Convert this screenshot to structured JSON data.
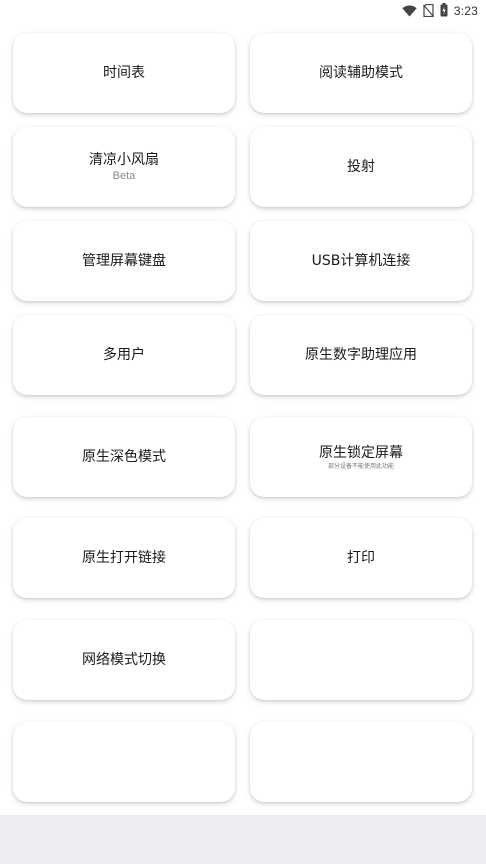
{
  "status_bar": {
    "time": "3:23",
    "icons": [
      "wifi-icon",
      "no-sim-icon",
      "battery-icon"
    ]
  },
  "tiles": [
    {
      "label": "时间表",
      "sub": "",
      "note": ""
    },
    {
      "label": "阅读辅助模式",
      "sub": "",
      "note": ""
    },
    {
      "label": "清凉小风扇",
      "sub": "Beta",
      "note": ""
    },
    {
      "label": "投射",
      "sub": "",
      "note": ""
    },
    {
      "label": "管理屏幕键盘",
      "sub": "",
      "note": ""
    },
    {
      "label": "USB计算机连接",
      "sub": "",
      "note": ""
    },
    {
      "label": "多用户",
      "sub": "",
      "note": ""
    },
    {
      "label": "原生数字助理应用",
      "sub": "",
      "note": ""
    },
    {
      "label": "原生深色模式",
      "sub": "",
      "note": ""
    },
    {
      "label": "原生锁定屏幕",
      "sub": "",
      "note": "部分设备不能使用此功能"
    },
    {
      "label": "原生打开链接",
      "sub": "",
      "note": ""
    },
    {
      "label": "打印",
      "sub": "",
      "note": ""
    },
    {
      "label": "网络模式切换",
      "sub": "",
      "note": ""
    },
    {
      "label": "",
      "sub": "",
      "note": ""
    },
    {
      "label": "",
      "sub": "",
      "note": ""
    },
    {
      "label": "",
      "sub": "",
      "note": ""
    }
  ]
}
